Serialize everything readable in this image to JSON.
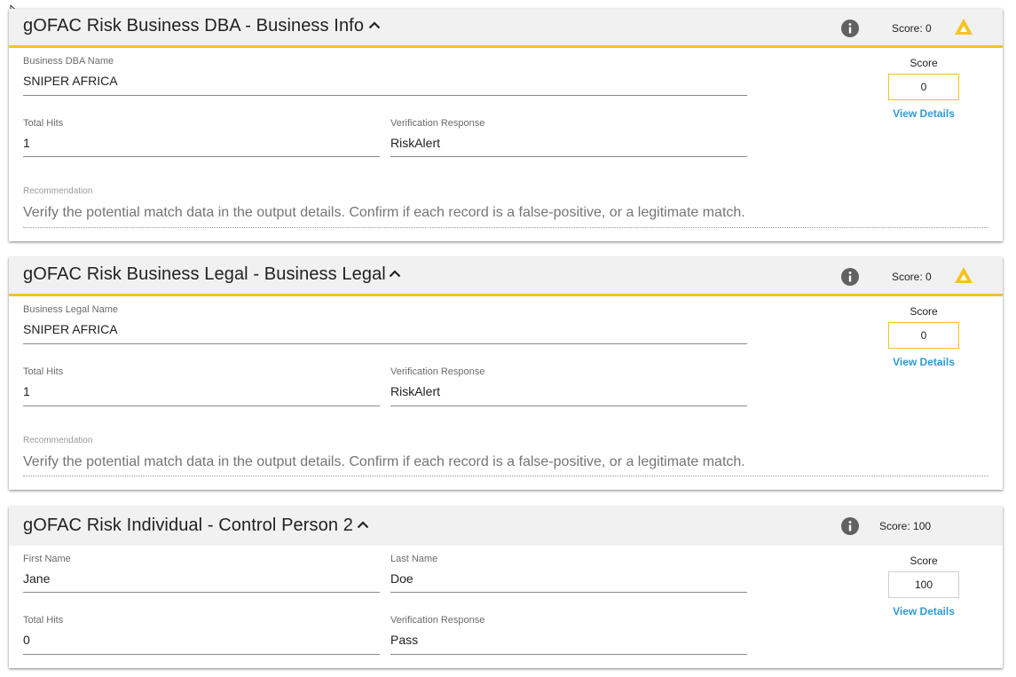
{
  "colors": {
    "accent_warning": "#f3c322",
    "link": "#2f9ad8",
    "header_bg": "#f1f1f1"
  },
  "cards": [
    {
      "title": "gOFAC Risk Business DBA - Business Info",
      "score_label": "Score: 0",
      "has_warning": true,
      "fields": {
        "name_label": "Business DBA Name",
        "name_value": "SNIPER AFRICA",
        "total_hits_label": "Total Hits",
        "total_hits_value": "1",
        "verification_label": "Verification Response",
        "verification_value": "RiskAlert",
        "recommendation_label": "Recommendation",
        "recommendation_value": "Verify the potential match data in the output details.  Confirm if each record is a false-positive, or a legitimate match."
      },
      "score": {
        "label": "Score",
        "value": "0",
        "details_link": "View Details"
      }
    },
    {
      "title": "gOFAC Risk Business Legal - Business Legal",
      "score_label": "Score: 0",
      "has_warning": true,
      "fields": {
        "name_label": "Business Legal Name",
        "name_value": "SNIPER AFRICA",
        "total_hits_label": "Total Hits",
        "total_hits_value": "1",
        "verification_label": "Verification Response",
        "verification_value": "RiskAlert",
        "recommendation_label": "Recommendation",
        "recommendation_value": "Verify the potential match data in the output details.  Confirm if each record is a false-positive, or a legitimate match."
      },
      "score": {
        "label": "Score",
        "value": "0",
        "details_link": "View Details"
      }
    },
    {
      "title": "gOFAC Risk Individual - Control Person 2",
      "score_label": "Score: 100",
      "has_warning": false,
      "fields": {
        "first_name_label": "First Name",
        "first_name_value": "Jane",
        "last_name_label": "Last Name",
        "last_name_value": "Doe",
        "total_hits_label": "Total Hits",
        "total_hits_value": "0",
        "verification_label": "Verification Response",
        "verification_value": "Pass"
      },
      "score": {
        "label": "Score",
        "value": "100",
        "details_link": "View Details"
      }
    }
  ]
}
